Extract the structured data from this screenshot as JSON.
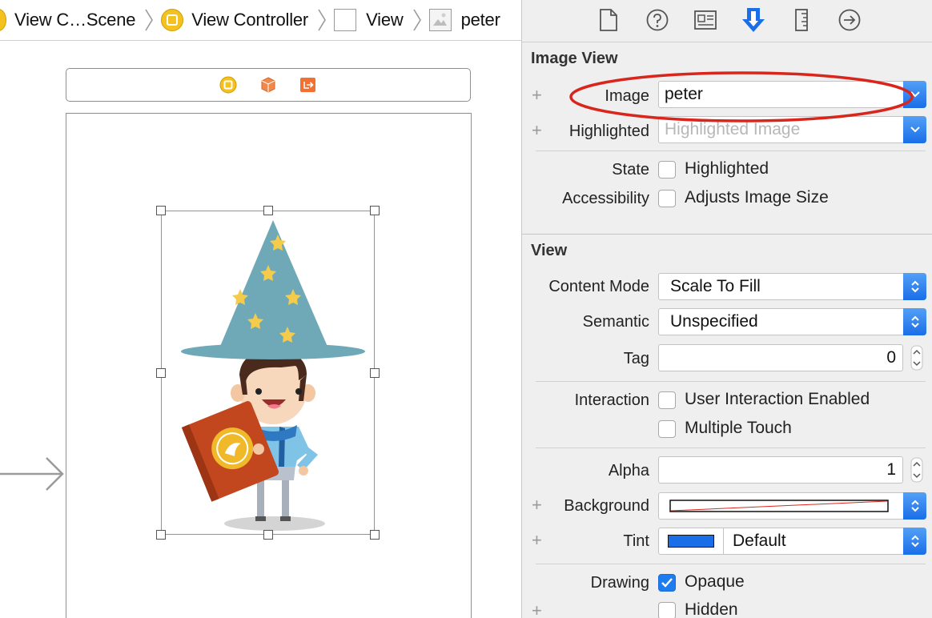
{
  "breadcrumb": {
    "items": [
      {
        "label": "View C…Scene",
        "icon": "scene-icon"
      },
      {
        "label": "View Controller",
        "icon": "view-controller-icon"
      },
      {
        "label": "View",
        "icon": "view-icon"
      },
      {
        "label": "peter",
        "icon": "image-view-icon"
      }
    ]
  },
  "scene_bar": {
    "icons": [
      "view-controller-icon",
      "first-responder-icon",
      "exit-icon"
    ]
  },
  "inspector": {
    "tabs": [
      "file-inspector-icon",
      "quick-help-icon",
      "identity-inspector-icon",
      "attributes-inspector-icon",
      "size-inspector-icon",
      "connections-inspector-icon"
    ],
    "active_tab": "attributes-inspector-icon",
    "image_view": {
      "title": "Image View",
      "image_label": "Image",
      "image_value": "peter",
      "highlighted_label": "Highlighted",
      "highlighted_placeholder": "Highlighted Image",
      "state_label": "State",
      "state_option": "Highlighted",
      "accessibility_label": "Accessibility",
      "accessibility_option": "Adjusts Image Size"
    },
    "view": {
      "title": "View",
      "content_mode_label": "Content Mode",
      "content_mode_value": "Scale To Fill",
      "semantic_label": "Semantic",
      "semantic_value": "Unspecified",
      "tag_label": "Tag",
      "tag_value": "0",
      "interaction_label": "Interaction",
      "user_interaction_option": "User Interaction Enabled",
      "multiple_touch_option": "Multiple Touch",
      "alpha_label": "Alpha",
      "alpha_value": "1",
      "background_label": "Background",
      "tint_label": "Tint",
      "tint_value": "Default",
      "drawing_label": "Drawing",
      "opaque_option": "Opaque",
      "hidden_option": "Hidden"
    }
  },
  "colors": {
    "accent": "#1c7cf0",
    "annotation_ellipse": "#d9261c",
    "selection": "#8a8ad8",
    "tint_swatch": "#1a6ee8"
  },
  "plus_symbol": "+"
}
